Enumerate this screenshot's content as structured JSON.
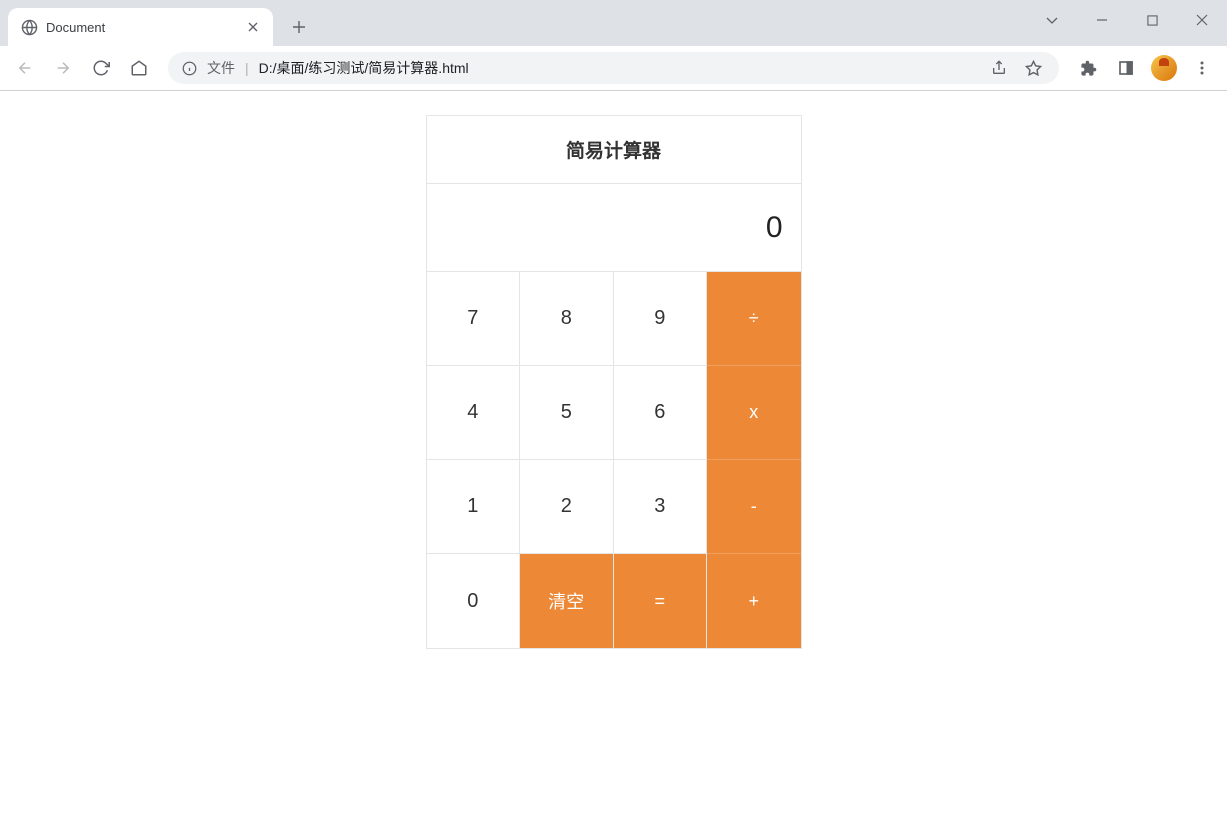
{
  "browser": {
    "tab": {
      "title": "Document"
    },
    "address": {
      "label": "文件",
      "url": "D:/桌面/练习测试/简易计算器.html"
    }
  },
  "calculator": {
    "title": "简易计算器",
    "display": "0",
    "buttons": {
      "row1": [
        "7",
        "8",
        "9",
        "÷"
      ],
      "row2": [
        "4",
        "5",
        "6",
        "x"
      ],
      "row3": [
        "1",
        "2",
        "3",
        "-"
      ],
      "row4": [
        "0",
        "清空",
        "=",
        "+"
      ]
    }
  }
}
